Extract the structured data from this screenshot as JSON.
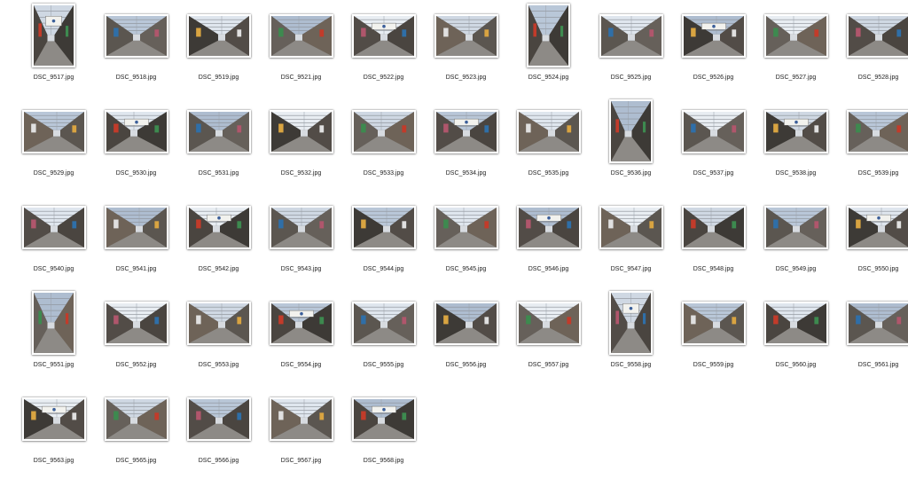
{
  "files": [
    {
      "name": "DSC_9517.jpg",
      "orientation": "portrait"
    },
    {
      "name": "DSC_9518.jpg",
      "orientation": "landscape"
    },
    {
      "name": "DSC_9519.jpg",
      "orientation": "landscape"
    },
    {
      "name": "DSC_9521.jpg",
      "orientation": "landscape"
    },
    {
      "name": "DSC_9522.jpg",
      "orientation": "landscape"
    },
    {
      "name": "DSC_9523.jpg",
      "orientation": "landscape"
    },
    {
      "name": "DSC_9524.jpg",
      "orientation": "portrait"
    },
    {
      "name": "DSC_9525.jpg",
      "orientation": "landscape"
    },
    {
      "name": "DSC_9526.jpg",
      "orientation": "landscape"
    },
    {
      "name": "DSC_9527.jpg",
      "orientation": "landscape"
    },
    {
      "name": "DSC_9528.jpg",
      "orientation": "landscape"
    },
    {
      "name": "DSC_9529.jpg",
      "orientation": "landscape"
    },
    {
      "name": "DSC_9530.jpg",
      "orientation": "landscape"
    },
    {
      "name": "DSC_9531.jpg",
      "orientation": "landscape"
    },
    {
      "name": "DSC_9532.jpg",
      "orientation": "landscape"
    },
    {
      "name": "DSC_9533.jpg",
      "orientation": "landscape"
    },
    {
      "name": "DSC_9534.jpg",
      "orientation": "landscape"
    },
    {
      "name": "DSC_9535.jpg",
      "orientation": "landscape"
    },
    {
      "name": "DSC_9536.jpg",
      "orientation": "portrait"
    },
    {
      "name": "DSC_9537.jpg",
      "orientation": "landscape"
    },
    {
      "name": "DSC_9538.jpg",
      "orientation": "landscape"
    },
    {
      "name": "DSC_9539.jpg",
      "orientation": "landscape"
    },
    {
      "name": "DSC_9540.jpg",
      "orientation": "landscape"
    },
    {
      "name": "DSC_9541.jpg",
      "orientation": "landscape"
    },
    {
      "name": "DSC_9542.jpg",
      "orientation": "landscape"
    },
    {
      "name": "DSC_9543.jpg",
      "orientation": "landscape"
    },
    {
      "name": "DSC_9544.jpg",
      "orientation": "landscape"
    },
    {
      "name": "DSC_9545.jpg",
      "orientation": "landscape"
    },
    {
      "name": "DSC_9546.jpg",
      "orientation": "landscape"
    },
    {
      "name": "DSC_9547.jpg",
      "orientation": "landscape"
    },
    {
      "name": "DSC_9548.jpg",
      "orientation": "landscape"
    },
    {
      "name": "DSC_9549.jpg",
      "orientation": "landscape"
    },
    {
      "name": "DSC_9550.jpg",
      "orientation": "landscape"
    },
    {
      "name": "DSC_9551.jpg",
      "orientation": "portrait"
    },
    {
      "name": "DSC_9552.jpg",
      "orientation": "landscape"
    },
    {
      "name": "DSC_9553.jpg",
      "orientation": "landscape"
    },
    {
      "name": "DSC_9554.jpg",
      "orientation": "landscape"
    },
    {
      "name": "DSC_9555.jpg",
      "orientation": "landscape"
    },
    {
      "name": "DSC_9556.jpg",
      "orientation": "landscape"
    },
    {
      "name": "DSC_9557.jpg",
      "orientation": "landscape"
    },
    {
      "name": "DSC_9558.jpg",
      "orientation": "portrait"
    },
    {
      "name": "DSC_9559.jpg",
      "orientation": "landscape"
    },
    {
      "name": "DSC_9560.jpg",
      "orientation": "landscape"
    },
    {
      "name": "DSC_9561.jpg",
      "orientation": "landscape"
    },
    {
      "name": "DSC_9563.jpg",
      "orientation": "landscape"
    },
    {
      "name": "DSC_9565.jpg",
      "orientation": "landscape"
    },
    {
      "name": "DSC_9566.jpg",
      "orientation": "landscape"
    },
    {
      "name": "DSC_9567.jpg",
      "orientation": "landscape"
    },
    {
      "name": "DSC_9568.jpg",
      "orientation": "landscape"
    }
  ]
}
